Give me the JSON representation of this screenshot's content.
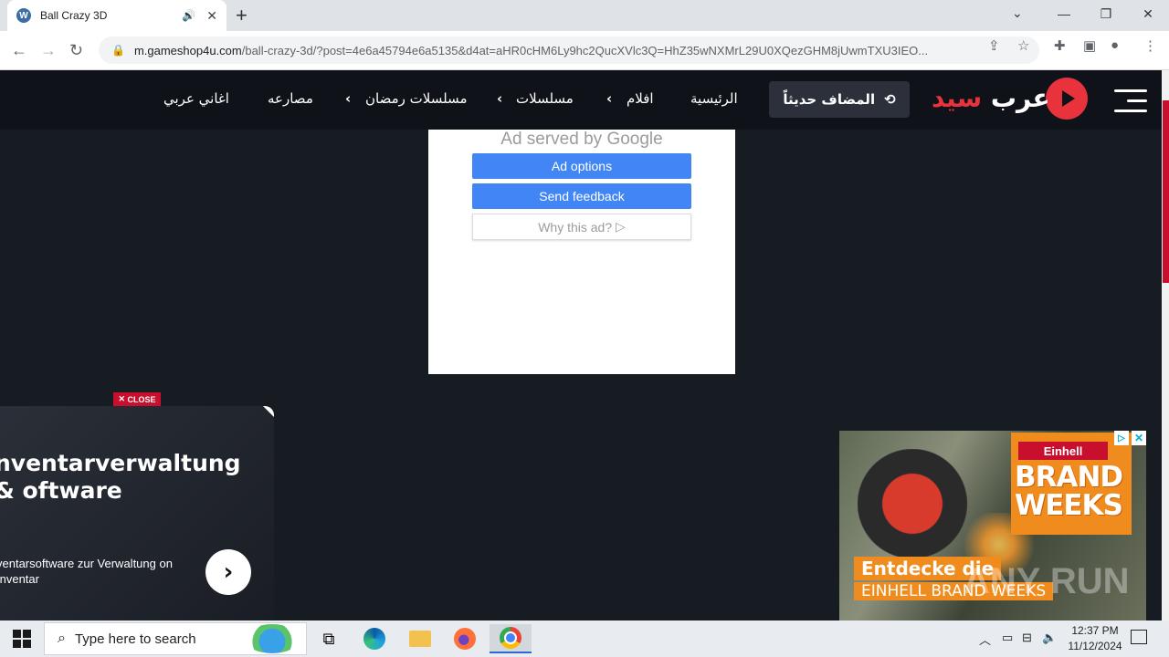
{
  "browser": {
    "tab_title": "Ball Crazy 3D",
    "tab_favicon": "wordpress-icon",
    "url_domain": "m.gameshop4u.com",
    "url_path": "/ball-crazy-3d/?post=4e6a45794e6a5135&d4at=aHR0cHM6Ly9hc2QucXVlc3Q=HhZ35wNXMrL29U0XQezGHM8jUwmTXU3IEO..."
  },
  "site": {
    "logo_white": "عرب",
    "logo_red": "سيد",
    "recent_button": "المضاف حديثاً",
    "menu": {
      "home": "الرئيسية",
      "movies": "افلام",
      "series": "مسلسلات",
      "ramadan": "مسلسلات رمضان",
      "wrestling": "مصارعه",
      "songs": "اغاني عربي"
    }
  },
  "google_ad": {
    "served_by": "Ad served by",
    "brand": "Google",
    "options_btn": "Ad options",
    "feedback_btn": "Send feedback",
    "why_btn": "Why this ad?"
  },
  "left_ad": {
    "close_label": "CLOSE",
    "headline": "nventarverwaltung & oftware",
    "subtext": "ventarsoftware zur Verwaltung on Inventar"
  },
  "right_ad": {
    "brand": "Einhell",
    "headline": "BRAND WEEKS",
    "tagline_1": "Entdecke die",
    "tagline_2": "EINHELL BRAND WEEKS"
  },
  "watermark": "ANY RUN",
  "taskbar": {
    "search_placeholder": "Type here to search",
    "time": "12:37 PM",
    "date": "11/12/2024"
  },
  "colors": {
    "accent_red": "#e8333c",
    "header_bg": "#0f1218",
    "page_bg": "#171b22",
    "google_blue": "#4285f4",
    "einhell_orange": "#f08c1e"
  }
}
